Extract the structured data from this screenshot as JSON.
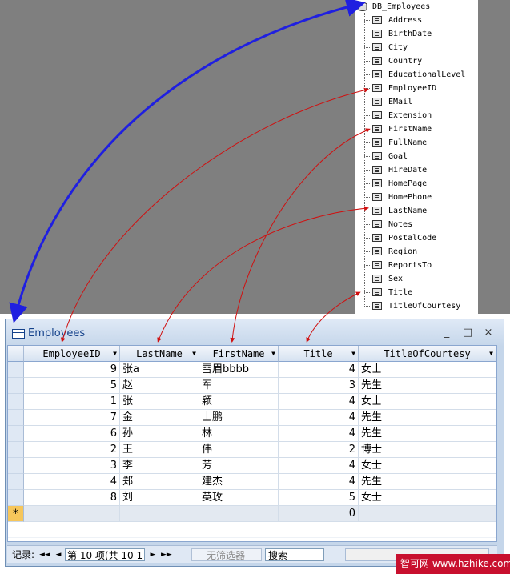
{
  "tree": {
    "root": "DB_Employees",
    "fields": [
      "Address",
      "BirthDate",
      "City",
      "Country",
      "EducationalLevel",
      "EmployeeID",
      "EMail",
      "Extension",
      "FirstName",
      "FullName",
      "Goal",
      "HireDate",
      "HomePage",
      "HomePhone",
      "LastName",
      "Notes",
      "PostalCode",
      "Region",
      "ReportsTo",
      "Sex",
      "Title",
      "TitleOfCourtesy"
    ]
  },
  "window": {
    "title": "Employees",
    "min": "_",
    "max": "□",
    "close": "×"
  },
  "grid": {
    "columns": [
      "EmployeeID",
      "LastName",
      "FirstName",
      "Title",
      "TitleOfCourtesy"
    ],
    "rows": [
      [
        "9",
        "张a",
        "雪眉bbbb",
        "4",
        "女士"
      ],
      [
        "5",
        "赵",
        "军",
        "3",
        "先生"
      ],
      [
        "1",
        "张",
        "颖",
        "4",
        "女士"
      ],
      [
        "7",
        "金",
        "士鹏",
        "4",
        "先生"
      ],
      [
        "6",
        "孙",
        "林",
        "4",
        "先生"
      ],
      [
        "2",
        "王",
        "伟",
        "2",
        "博士"
      ],
      [
        "3",
        "李",
        "芳",
        "4",
        "女士"
      ],
      [
        "4",
        "郑",
        "建杰",
        "4",
        "先生"
      ],
      [
        "8",
        "刘",
        "英玫",
        "5",
        "女士"
      ]
    ],
    "new_row": {
      "marker": "*",
      "title_default": "0"
    }
  },
  "nav": {
    "label": "记录:",
    "first": "◄◄",
    "prev": "◄",
    "record": "第 10 项(共 10 1",
    "next": "►",
    "last": "►►",
    "filter": "无筛选器",
    "search": "搜索"
  },
  "watermark": "智可网 www.hzhike.com",
  "colors": {
    "tree_arrow": "#1f1fe0",
    "field_arrow": "#d01010"
  }
}
